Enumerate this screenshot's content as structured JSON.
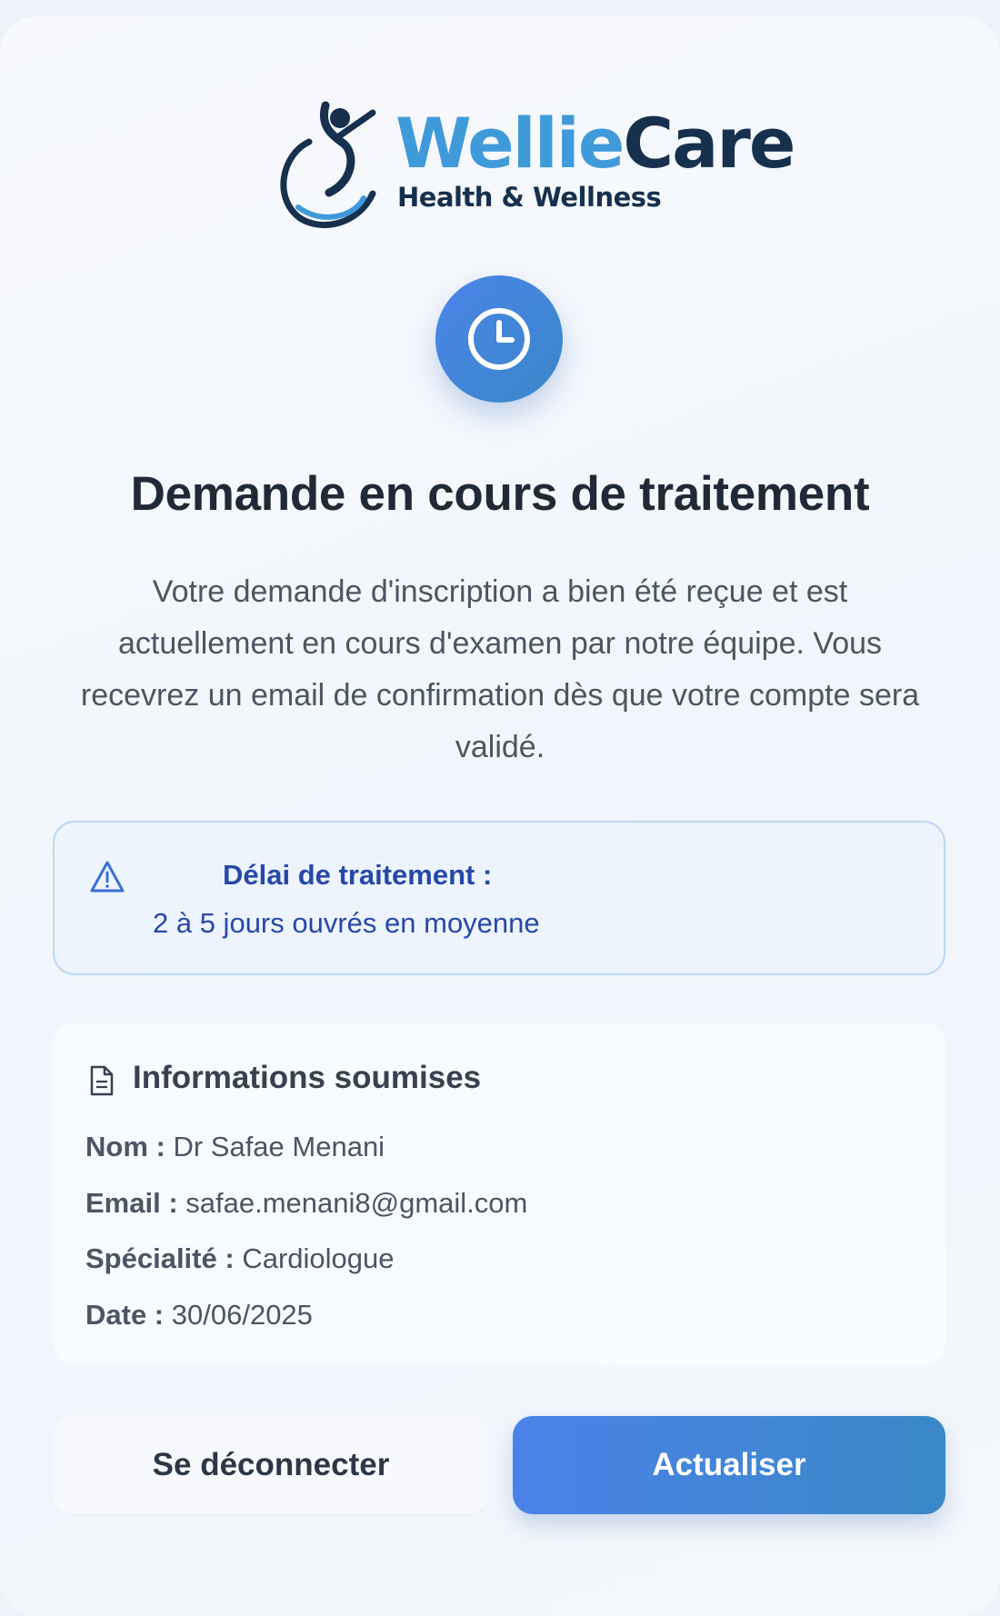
{
  "brand": {
    "name_part1": "Wellie",
    "name_part2": "Care",
    "tagline": "Health & Wellness",
    "colors": {
      "primary_blue": "#3f9ad9",
      "navy": "#16304d"
    }
  },
  "status": {
    "icon": "clock-icon",
    "title": "Demande en cours de traitement",
    "description": "Votre demande d'inscription a bien été reçue et est actuellement en cours d'examen par notre équipe. Vous recevrez un email de confirmation dès que votre compte sera validé."
  },
  "notice": {
    "icon": "warning-triangle-icon",
    "title": "Délai de traitement :",
    "text": "2 à 5 jours ouvrés en moyenne"
  },
  "info": {
    "icon": "document-icon",
    "title": "Informations soumises",
    "name_label": "Nom :",
    "name_value": "Dr Safae Menani",
    "email_label": "Email :",
    "email_value": "safae.menani8@gmail.com",
    "specialty_label": "Spécialité :",
    "specialty_value": "Cardiologue",
    "date_label": "Date :",
    "date_value": "30/06/2025"
  },
  "actions": {
    "logout_label": "Se déconnecter",
    "refresh_label": "Actualiser",
    "accent": "#4b82e8"
  }
}
